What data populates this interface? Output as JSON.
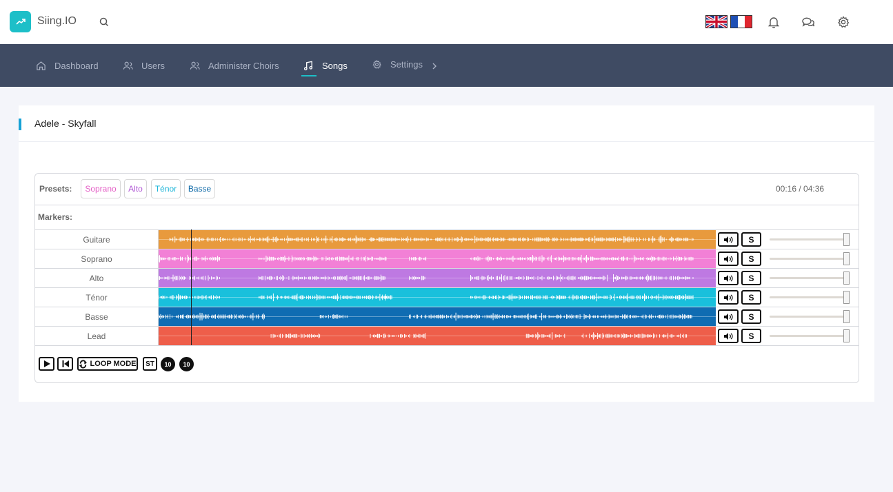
{
  "brand": "Siing.IO",
  "nav": {
    "items": [
      {
        "label": "Dashboard"
      },
      {
        "label": "Users"
      },
      {
        "label": "Administer Choirs"
      },
      {
        "label": "Songs"
      },
      {
        "label": "Settings"
      }
    ]
  },
  "song": {
    "title": "Adele - Skyfall"
  },
  "player": {
    "presets_label": "Presets:",
    "presets": [
      {
        "label": "Soprano",
        "color": "#e45fc6"
      },
      {
        "label": "Alto",
        "color": "#b25ad6"
      },
      {
        "label": "Ténor",
        "color": "#1cb5d8"
      },
      {
        "label": "Basse",
        "color": "#0f6aa8"
      }
    ],
    "time": "00:16 / 04:36",
    "markers_label": "Markers:",
    "playhead_position": 0.058,
    "tracks": [
      {
        "name": "Guitare",
        "color": "#e89a3d",
        "mute": "🔊",
        "solo": "S",
        "volume": 1.0
      },
      {
        "name": "Soprano",
        "color": "#f280d6",
        "mute": "🔊",
        "solo": "S",
        "volume": 1.0
      },
      {
        "name": "Alto",
        "color": "#be79e2",
        "mute": "🔊",
        "solo": "S",
        "volume": 1.0
      },
      {
        "name": "Ténor",
        "color": "#19c0dc",
        "mute": "🔊",
        "solo": "S",
        "volume": 1.0
      },
      {
        "name": "Basse",
        "color": "#0f6cb2",
        "mute": "🔊",
        "solo": "S",
        "volume": 1.0
      },
      {
        "name": "Lead",
        "color": "#ee5e4a",
        "mute": "🔊",
        "solo": "S",
        "volume": 1.0
      }
    ],
    "controls": {
      "loop_label": "LOOP MODE",
      "st_label": "ST",
      "rewind_label": "10",
      "forward_label": "10"
    }
  }
}
